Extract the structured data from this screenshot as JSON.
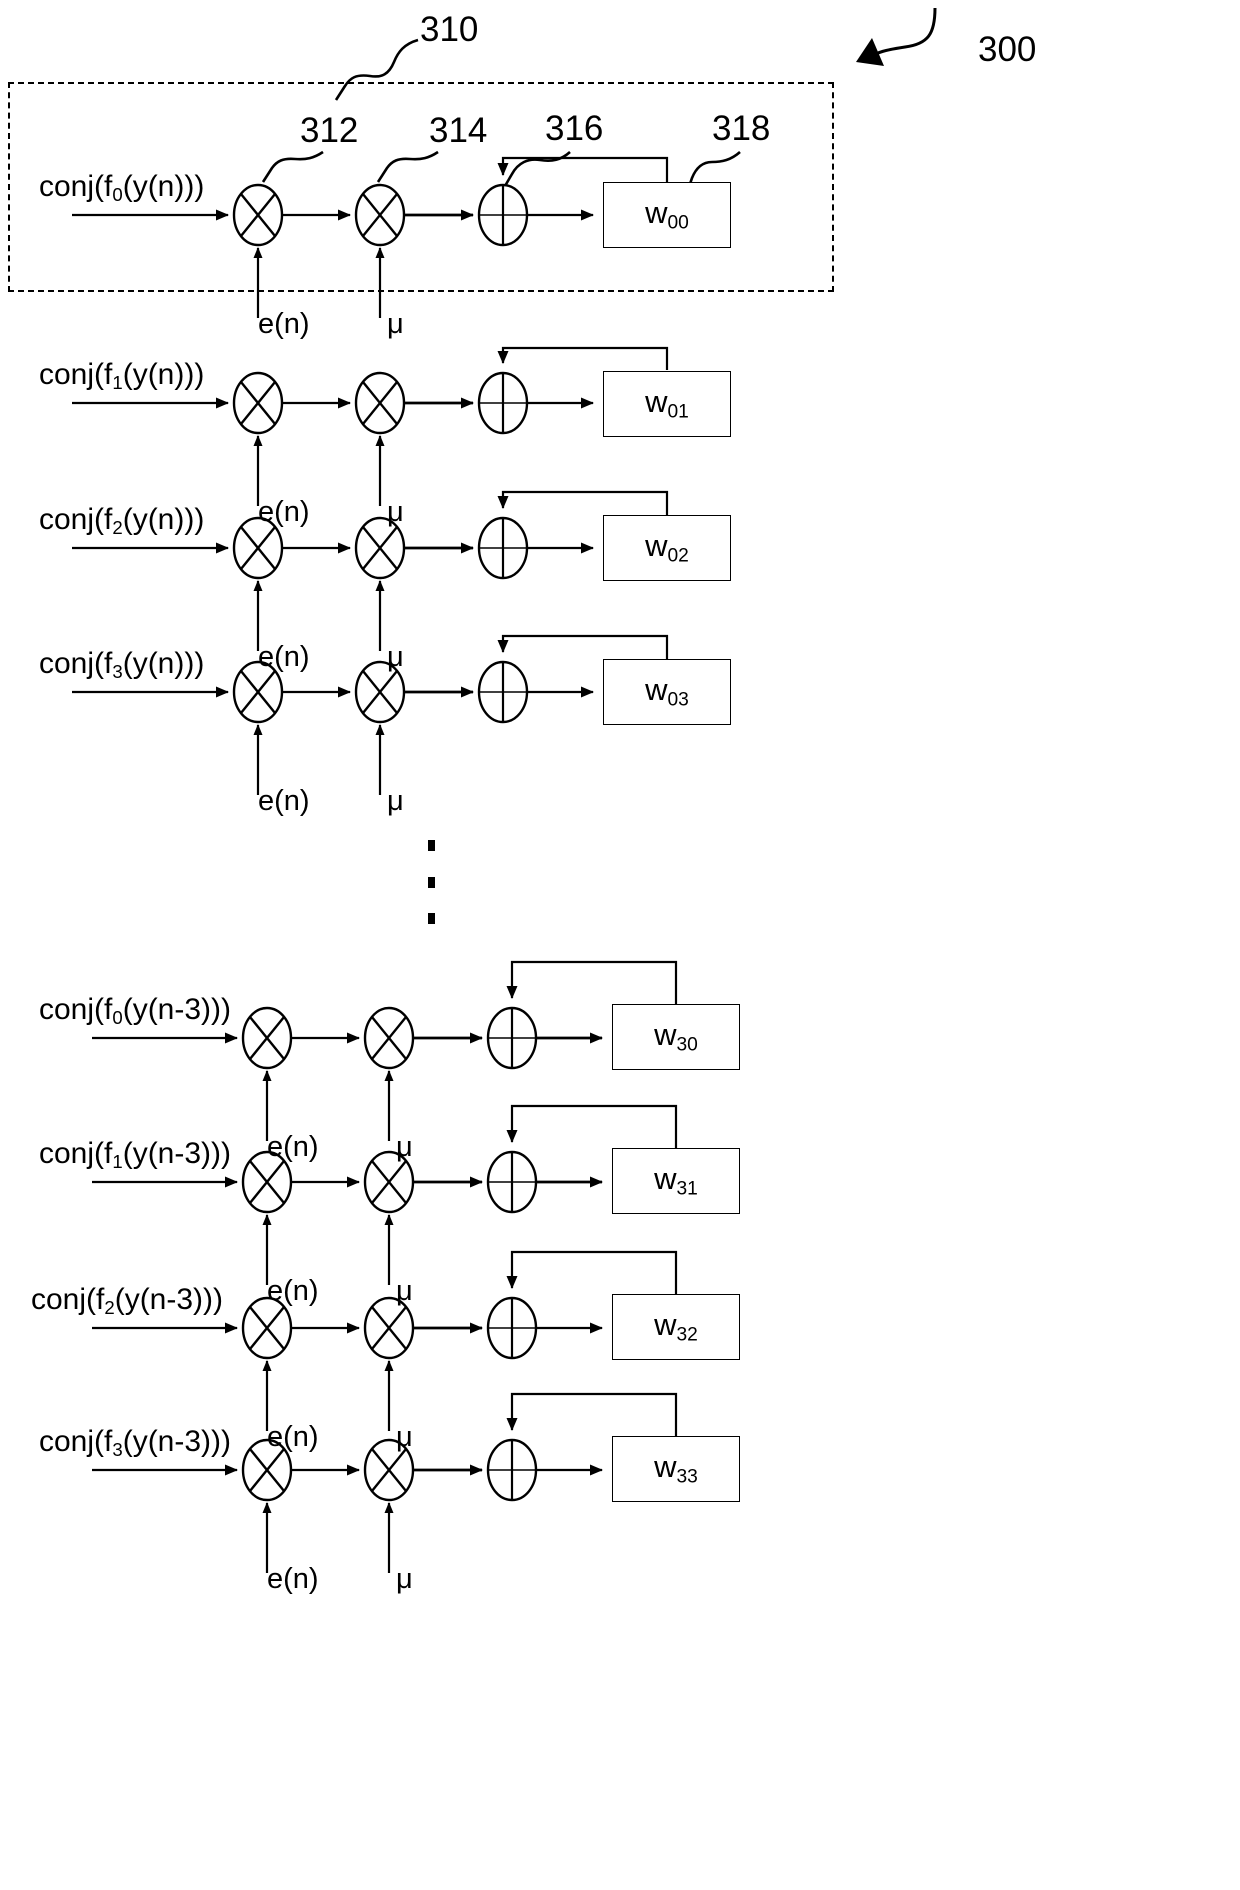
{
  "figure": {
    "figure_number": "300",
    "group_callout": "310",
    "callouts": [
      {
        "id": "312",
        "target": "first-multiplier"
      },
      {
        "id": "314",
        "target": "second-multiplier"
      },
      {
        "id": "316",
        "target": "adder"
      },
      {
        "id": "318",
        "target": "weight-register"
      }
    ],
    "operator_symbols": {
      "multiply": "multiply-circle-icon",
      "add": "sum-circle-icon"
    },
    "inputs": {
      "error_signal": "e(n)",
      "step_size": "μ"
    },
    "ellipsis": "·",
    "rows": [
      {
        "input": "conj(f",
        "input_sub": "0",
        "input_tail": "(y(n)))",
        "weight": "w",
        "weight_sub": "00",
        "e": "e(n)",
        "mu": "μ"
      },
      {
        "input": "conj(f",
        "input_sub": "1",
        "input_tail": "(y(n)))",
        "weight": "w",
        "weight_sub": "01",
        "e": "e(n)",
        "mu": "μ"
      },
      {
        "input": "conj(f",
        "input_sub": "2",
        "input_tail": "(y(n)))",
        "weight": "w",
        "weight_sub": "02",
        "e": "e(n)",
        "mu": "μ"
      },
      {
        "input": "conj(f",
        "input_sub": "3",
        "input_tail": "(y(n)))",
        "weight": "w",
        "weight_sub": "03",
        "e": "e(n)",
        "mu": "μ"
      },
      {
        "input": "conj(f",
        "input_sub": "0",
        "input_tail": "(y(n-3)))",
        "weight": "w",
        "weight_sub": "30",
        "e": "e(n)",
        "mu": "μ"
      },
      {
        "input": "conj(f",
        "input_sub": "1",
        "input_tail": "(y(n-3)))",
        "weight": "w",
        "weight_sub": "31",
        "e": "e(n)",
        "mu": "μ"
      },
      {
        "input": "conj(f",
        "input_sub": "2",
        "input_tail": "(y(n-3)))",
        "weight": "w",
        "weight_sub": "32",
        "e": "e(n)",
        "mu": "μ"
      },
      {
        "input": "conj(f",
        "input_sub": "3",
        "input_tail": "(y(n-3)))",
        "weight": "w",
        "weight_sub": "33",
        "e": "e(n)",
        "mu": "μ"
      }
    ]
  },
  "colors": {
    "ink": "#000000",
    "background": "#ffffff"
  }
}
